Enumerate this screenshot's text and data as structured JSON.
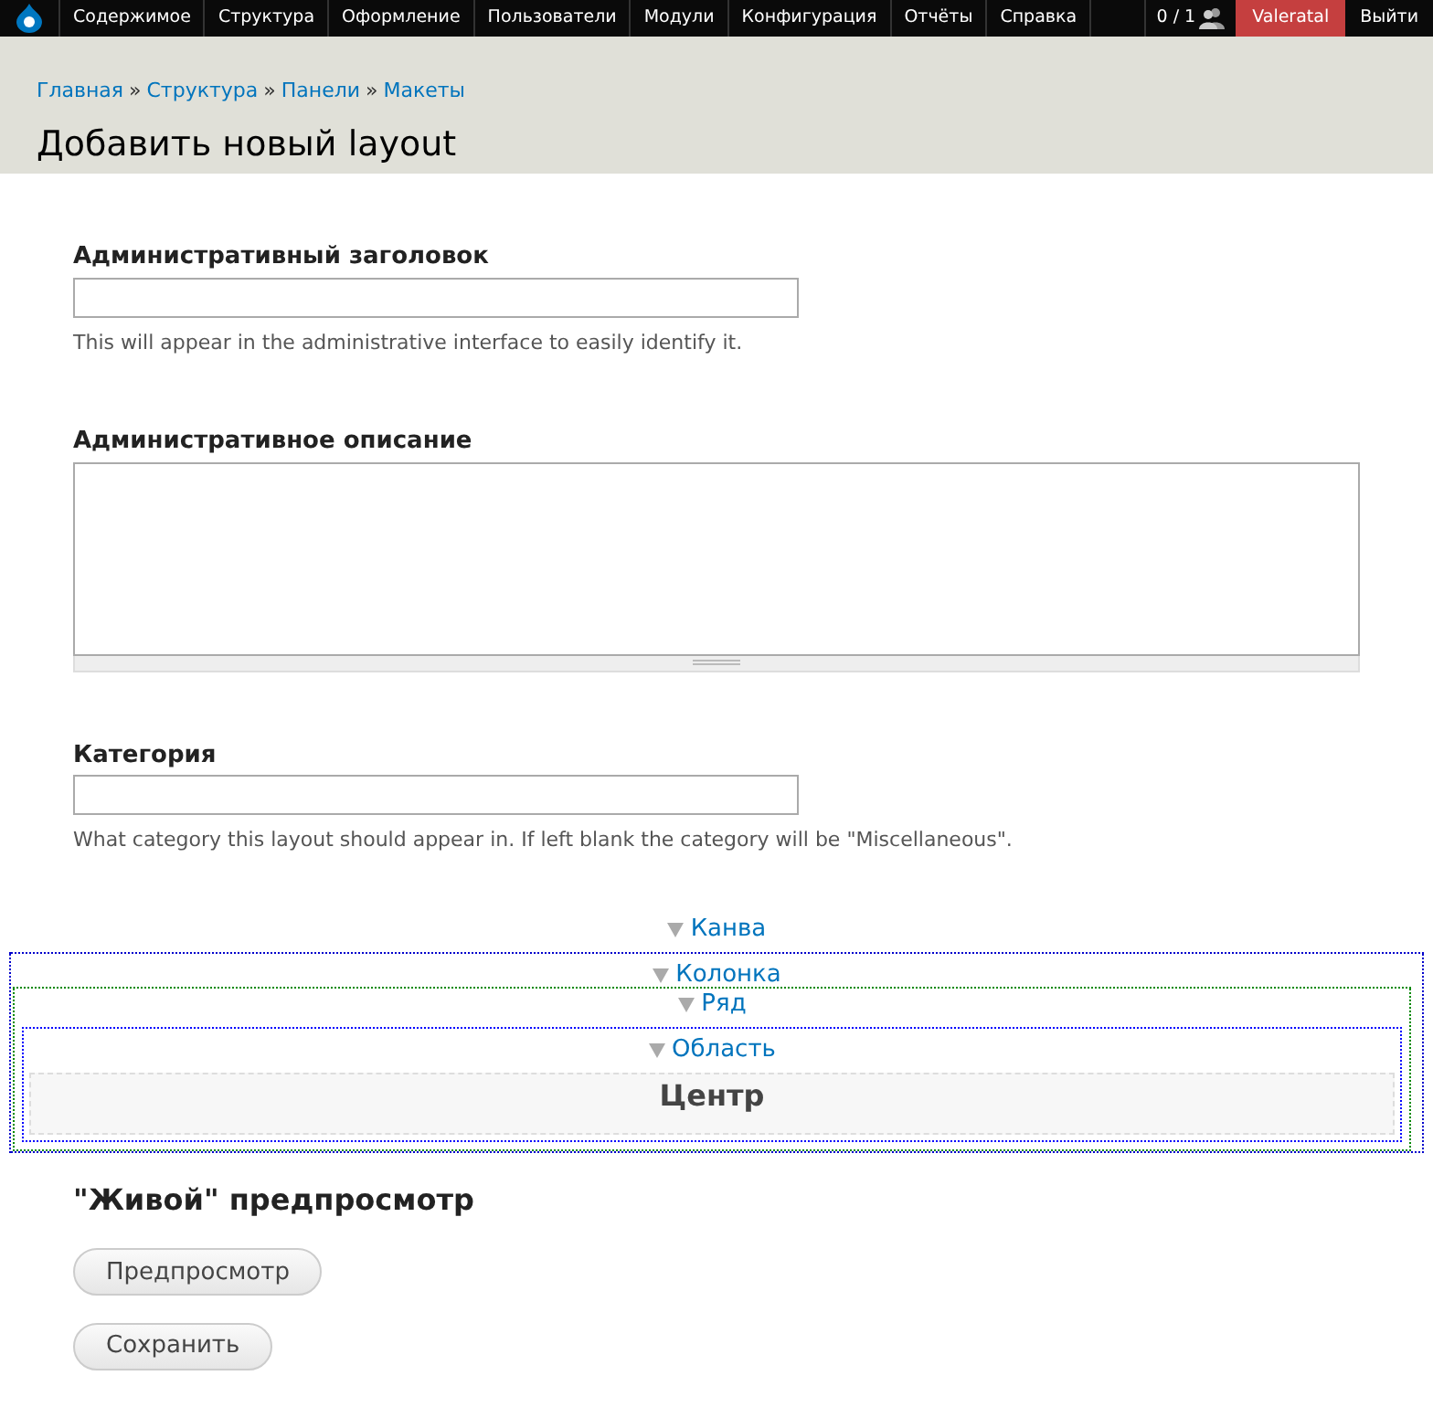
{
  "toolbar": {
    "menu": [
      "Содержимое",
      "Структура",
      "Оформление",
      "Пользователи",
      "Модули",
      "Конфигурация",
      "Отчёты",
      "Справка"
    ],
    "users_count": "0 / 1",
    "user": "Valeratal",
    "logout": "Выйти"
  },
  "breadcrumb": [
    "Главная",
    "Структура",
    "Панели",
    "Макеты"
  ],
  "breadcrumb_separator": "»",
  "page_title": "Добавить новый layout",
  "fields": [
    {
      "kind": "text",
      "label": "Административный заголовок",
      "description": "This will appear in the administrative interface to easily identify it."
    },
    {
      "kind": "textarea",
      "label": "Административное описание"
    },
    {
      "kind": "text",
      "label": "Категория",
      "description": "What category this layout should appear in. If left blank the category will be \"Miscellaneous\"."
    }
  ],
  "layout": {
    "kind": "canvas",
    "label": "Канва",
    "children": [
      {
        "kind": "column",
        "label": "Колонка",
        "children": [
          {
            "kind": "row",
            "label": "Ряд",
            "children": [
              {
                "kind": "region",
                "label": "Область",
                "children": [
                  {
                    "kind": "pane",
                    "label": "Центр"
                  }
                ]
              }
            ]
          }
        ]
      }
    ]
  },
  "preview_heading": "\"Живой\" предпросмотр",
  "buttons": [
    "Предпросмотр",
    "Сохранить"
  ]
}
